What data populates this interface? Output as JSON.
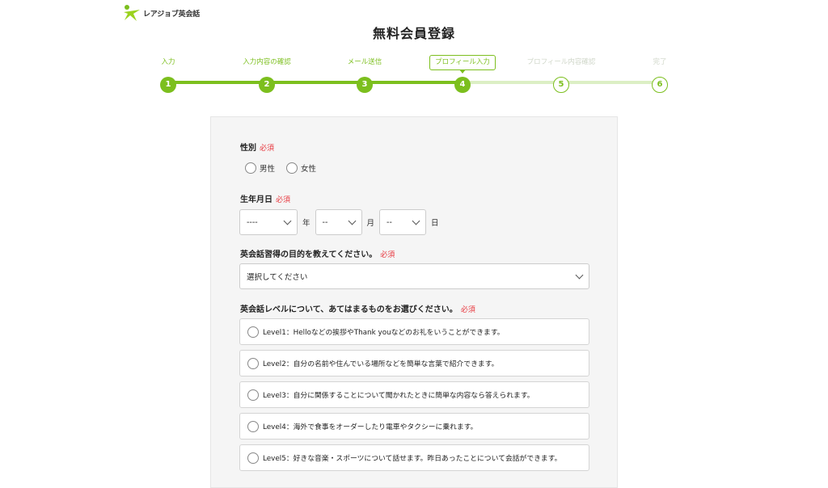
{
  "logo": {
    "text": "レアジョブ英会話"
  },
  "title": "無料会員登録",
  "steps": [
    {
      "num": "1",
      "label": "入力"
    },
    {
      "num": "2",
      "label": "入力内容の確認"
    },
    {
      "num": "3",
      "label": "メール送信"
    },
    {
      "num": "4",
      "label": "プロフィール入力"
    },
    {
      "num": "5",
      "label": "プロフィール内容確認"
    },
    {
      "num": "6",
      "label": "完了"
    }
  ],
  "colors": {
    "accent": "#7cbf1e",
    "accent_light": "#dcefc4",
    "required": "#e8363d"
  },
  "form": {
    "required_label": "必須",
    "gender": {
      "label": "性別",
      "options": [
        "男性",
        "女性"
      ]
    },
    "birthdate": {
      "label": "生年月日",
      "year_value": "----",
      "year_unit": "年",
      "month_value": "--",
      "month_unit": "月",
      "day_value": "--",
      "day_unit": "日"
    },
    "purpose": {
      "label": "英会話習得の目的を教えてください。",
      "value": "選択してください"
    },
    "level": {
      "label": "英会話レベルについて、あてはまるものをお選びください。",
      "options": [
        "Level1：Helloなどの挨拶やThank youなどのお礼をいうことができます。",
        "Level2：自分の名前や住んでいる場所などを簡単な言葉で紹介できます。",
        "Level3：自分に関係することについて聞かれたときに簡単な内容なら答えられます。",
        "Level4：海外で食事をオーダーしたり電車やタクシーに乗れます。",
        "Level5：好きな音楽・スポーツについて話せます。昨日あったことについて会話ができます。"
      ]
    }
  }
}
